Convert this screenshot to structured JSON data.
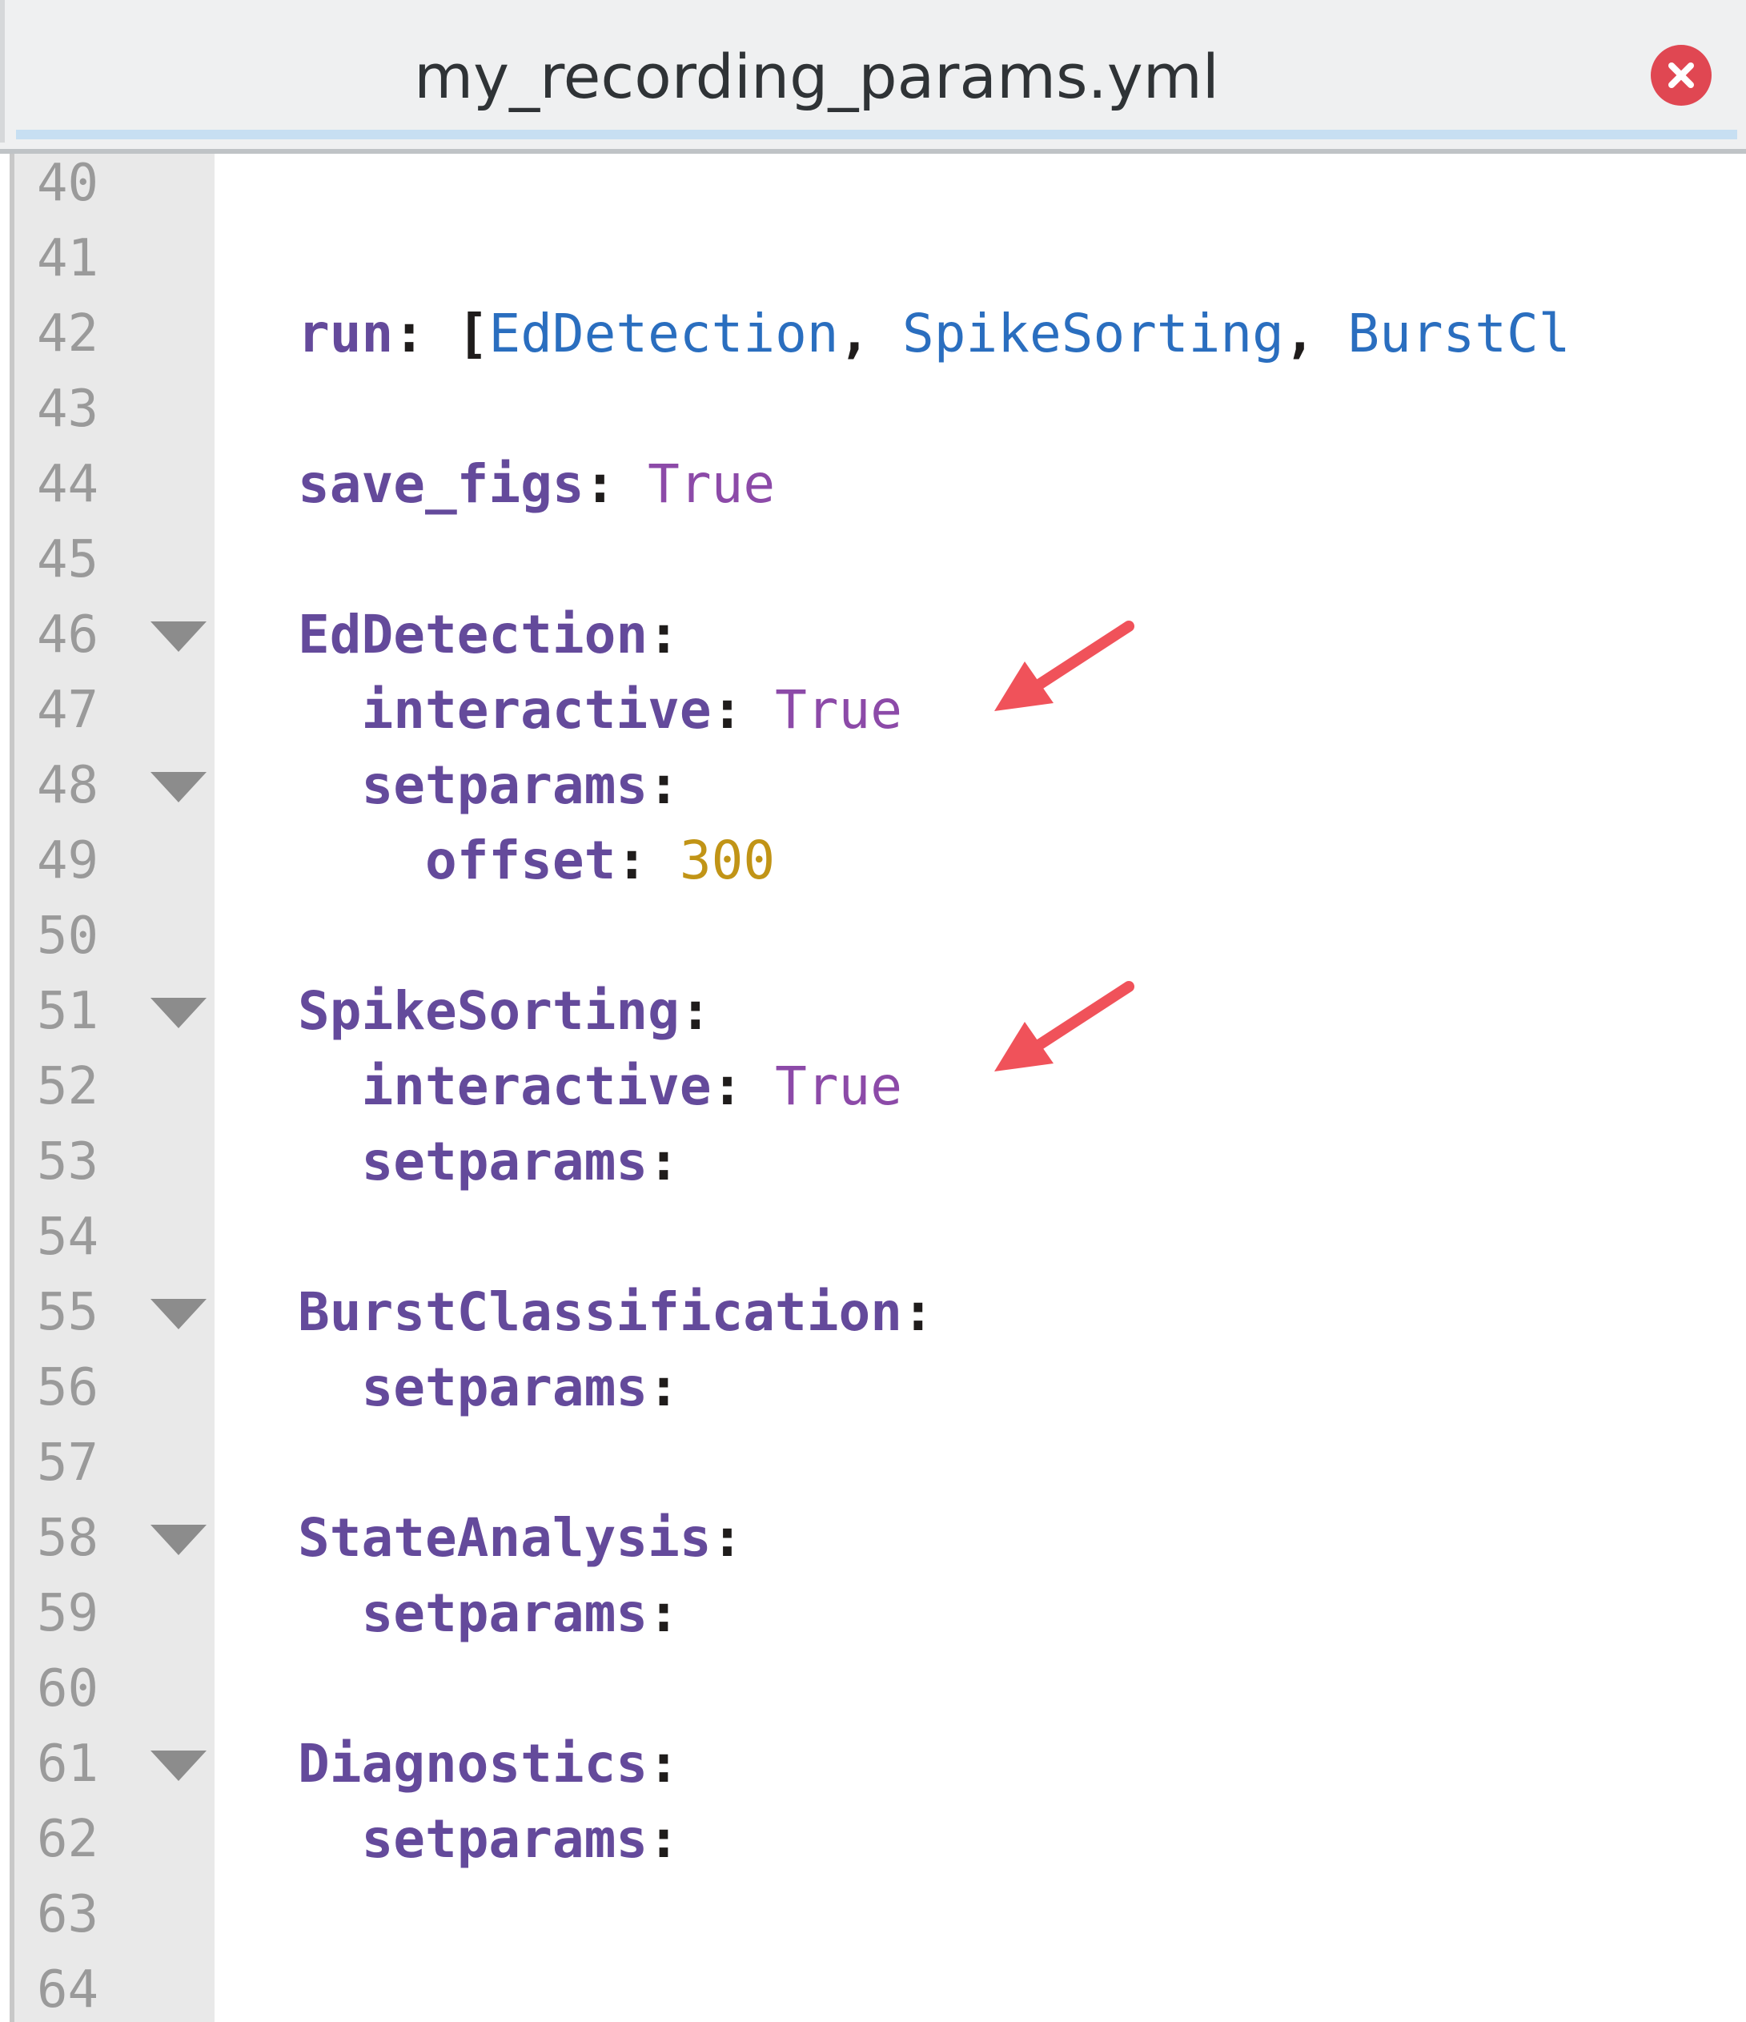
{
  "tab": {
    "title": "my_recording_params.yml",
    "close_icon": "close-icon"
  },
  "colors": {
    "key": "#644a9b",
    "boolean": "#8c4aa8",
    "number": "#c19416",
    "reference": "#2a6ebf",
    "annotation_arrow": "#f0525a"
  },
  "line_numbers": [
    "40",
    "41",
    "42",
    "43",
    "44",
    "45",
    "46",
    "47",
    "48",
    "49",
    "50",
    "51",
    "52",
    "53",
    "54",
    "55",
    "56",
    "57",
    "58",
    "59",
    "60",
    "61",
    "62",
    "63",
    "64"
  ],
  "fold_markers_on_lines": [
    "46",
    "48",
    "51",
    "55",
    "58",
    "61"
  ],
  "code": {
    "l42": {
      "key": "run",
      "colon": ":",
      "open": " [",
      "items": [
        "EdDetection",
        "SpikeSorting",
        "BurstCl"
      ],
      "sep": ", "
    },
    "l44": {
      "key": "save_figs",
      "colon": ":",
      "value": " True"
    },
    "l46": {
      "key": "EdDetection",
      "colon": ":"
    },
    "l47": {
      "indent": "  ",
      "key": "interactive",
      "colon": ":",
      "value": " True"
    },
    "l48": {
      "indent": "  ",
      "key": "setparams",
      "colon": ":"
    },
    "l49": {
      "indent": "    ",
      "key": "offset",
      "colon": ":",
      "value": " 300"
    },
    "l51": {
      "key": "SpikeSorting",
      "colon": ":"
    },
    "l52": {
      "indent": "  ",
      "key": "interactive",
      "colon": ":",
      "value": " True"
    },
    "l53": {
      "indent": "  ",
      "key": "setparams",
      "colon": ":"
    },
    "l55": {
      "key": "BurstClassification",
      "colon": ":"
    },
    "l56": {
      "indent": "  ",
      "key": "setparams",
      "colon": ":"
    },
    "l58": {
      "key": "StateAnalysis",
      "colon": ":"
    },
    "l59": {
      "indent": "  ",
      "key": "setparams",
      "colon": ":"
    },
    "l61": {
      "key": "Diagnostics",
      "colon": ":"
    },
    "l62": {
      "indent": "  ",
      "key": "setparams",
      "colon": ":"
    }
  },
  "annotations": [
    "arrow-icon",
    "arrow-icon"
  ]
}
